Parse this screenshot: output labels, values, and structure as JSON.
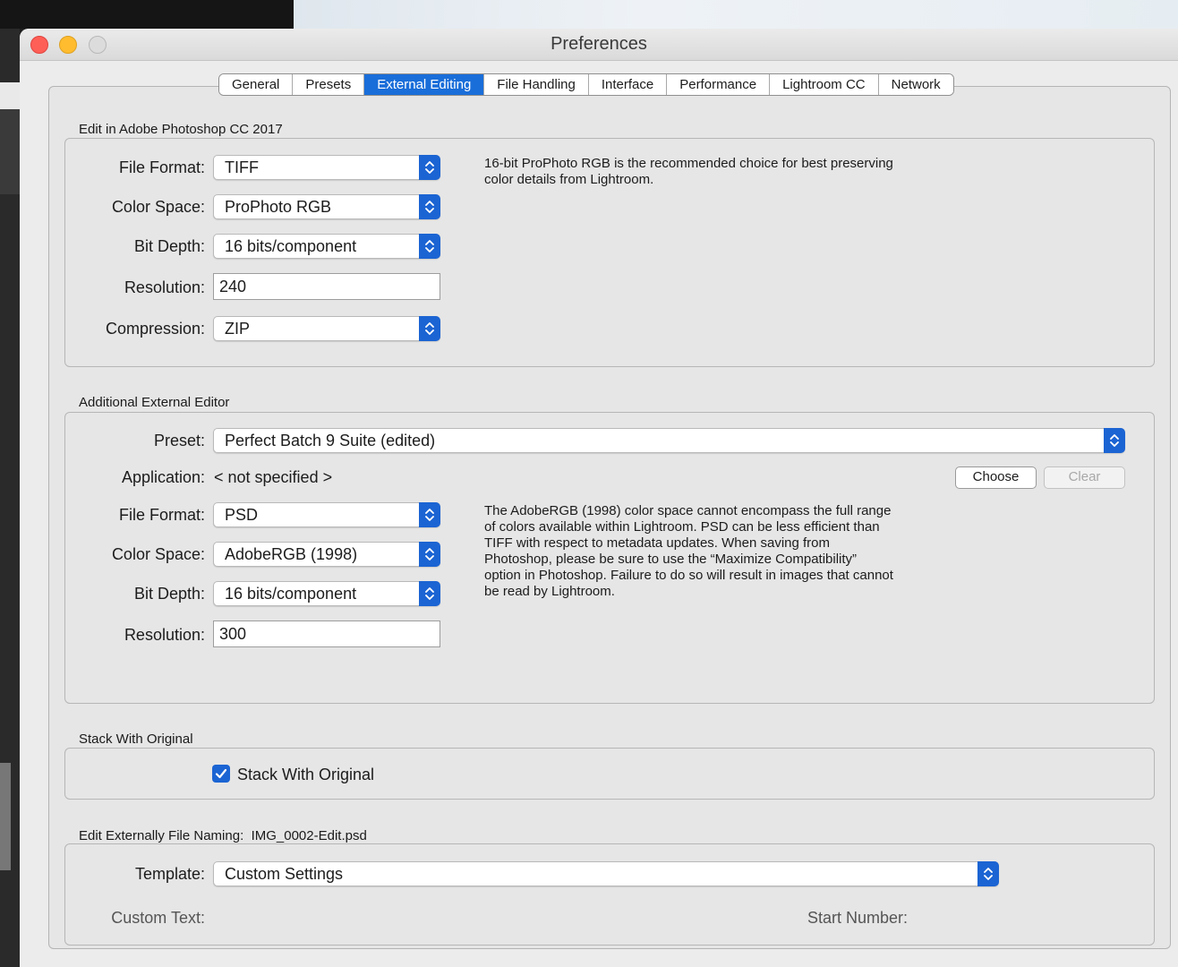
{
  "window": {
    "title": "Preferences"
  },
  "tabs": [
    {
      "label": "General"
    },
    {
      "label": "Presets"
    },
    {
      "label": "External Editing",
      "active": true
    },
    {
      "label": "File Handling"
    },
    {
      "label": "Interface"
    },
    {
      "label": "Performance"
    },
    {
      "label": "Lightroom CC"
    },
    {
      "label": "Network"
    }
  ],
  "photoshop": {
    "section_title": "Edit in Adobe Photoshop CC 2017",
    "file_format": {
      "label": "File Format:",
      "value": "TIFF"
    },
    "color_space": {
      "label": "Color Space:",
      "value": "ProPhoto RGB"
    },
    "bit_depth": {
      "label": "Bit Depth:",
      "value": "16 bits/component"
    },
    "resolution": {
      "label": "Resolution:",
      "value": "240"
    },
    "compression": {
      "label": "Compression:",
      "value": "ZIP"
    },
    "description": [
      "16-bit ProPhoto RGB is the recommended choice for best preserving",
      "color details from Lightroom."
    ]
  },
  "additional": {
    "section_title": "Additional External Editor",
    "preset": {
      "label": "Preset:",
      "value": "Perfect Batch 9 Suite (edited)"
    },
    "application": {
      "label": "Application:",
      "value": "< not specified >"
    },
    "choose_label": "Choose",
    "clear_label": "Clear",
    "file_format": {
      "label": "File Format:",
      "value": "PSD"
    },
    "color_space": {
      "label": "Color Space:",
      "value": "AdobeRGB (1998)"
    },
    "bit_depth": {
      "label": "Bit Depth:",
      "value": "16 bits/component"
    },
    "resolution": {
      "label": "Resolution:",
      "value": "300"
    },
    "description": [
      "The AdobeRGB (1998) color space cannot encompass the full range",
      "of colors available within Lightroom. PSD can be less efficient than",
      "TIFF with respect to metadata updates. When saving from",
      "Photoshop, please be sure to use the “Maximize Compatibility”",
      "option in Photoshop. Failure to do so will result in images that cannot",
      "be read by Lightroom."
    ]
  },
  "stack": {
    "section_title": "Stack With Original",
    "checkbox_label": "Stack With Original",
    "checked": true
  },
  "naming": {
    "section_title": "Edit Externally File Naming:",
    "example": "IMG_0002-Edit.psd",
    "template": {
      "label": "Template:",
      "value": "Custom Settings"
    },
    "custom_text_label": "Custom Text:",
    "start_number_label": "Start Number:"
  },
  "colors": {
    "accent": "#1b64d3",
    "tab_active": "#1a6ed9",
    "close": "#fe5f57",
    "minimize": "#febc2e"
  },
  "icons": {
    "popup_arrow": "chevron-up-down-icon",
    "check": "checkmark-icon"
  }
}
